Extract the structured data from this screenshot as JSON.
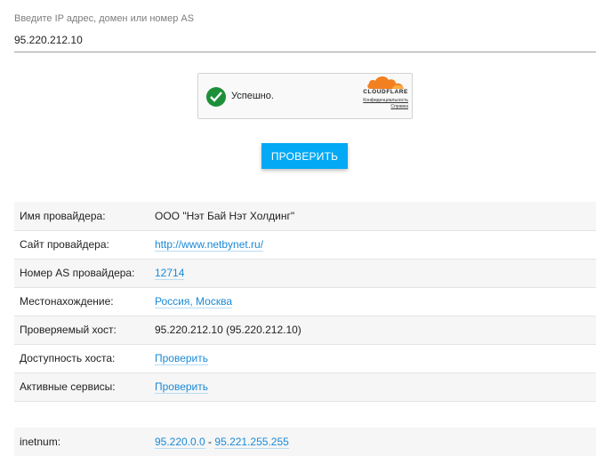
{
  "search": {
    "label": "Введите IP адрес, домен или номер AS",
    "value": "95.220.212.10"
  },
  "captcha": {
    "status": "Успешно.",
    "brand": "CLOUDFLARE",
    "privacy_link": "Конфиденциальность",
    "help_link": "Справка",
    "success_color": "#1e8f39"
  },
  "action": {
    "check_button": "ПРОВЕРИТЬ",
    "color": "#03a9f4"
  },
  "info": {
    "rows": [
      {
        "key": "Имя провайдера:",
        "value": "ООО \"Нэт Бай Нэт Холдинг\""
      },
      {
        "key": "Сайт провайдера:",
        "value": "http://www.netbynet.ru/"
      },
      {
        "key": "Номер AS провайдера:",
        "value": "12714"
      },
      {
        "key": "Местонахождение:",
        "value": "Россия, Москва"
      },
      {
        "key": "Проверяемый хост:",
        "value": "95.220.212.10 (95.220.212.10)"
      },
      {
        "key": "Доступность хоста:",
        "value": "Проверить"
      },
      {
        "key": "Активные сервисы:",
        "value": "Проверить"
      }
    ]
  },
  "inetnum": {
    "key": "inetnum:",
    "start": "95.220.0.0",
    "separator": " - ",
    "end": "95.221.255.255"
  }
}
